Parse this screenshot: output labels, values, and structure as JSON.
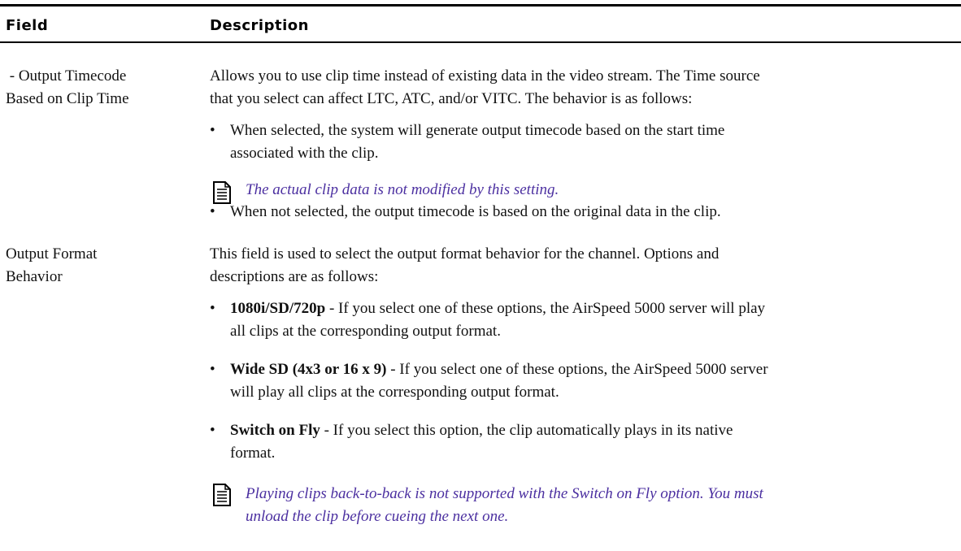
{
  "header": {
    "field": "Field",
    "description": "Description"
  },
  "row1": {
    "field_line1": " - Output Timecode",
    "field_line2": "Based on Clip Time",
    "desc_line1": "Allows you to use clip time instead of existing data in the video stream. The Time source",
    "desc_line2": "that you select can affect LTC, ATC, and/or VITC. The behavior is as follows:",
    "bullet1_line1": "When selected, the system will generate output timecode based on the start time",
    "bullet1_line2": "associated with the clip.",
    "note": "The actual clip data is not modified by this setting.",
    "bullet2": "When not selected, the output timecode is based on the original data in the clip."
  },
  "row2": {
    "field_line1": "Output Format",
    "field_line2": "Behavior",
    "desc_line1": "This field is used to select the output format behavior for the channel. Options and",
    "desc_line2": "descriptions are as follows:",
    "bullets": [
      {
        "bold": "1080i/SD/720p",
        "rest_line1": " - If you select one of these options, the AirSpeed 5000 server will play",
        "line2": "all clips at the corresponding output format."
      },
      {
        "bold": "Wide SD (4x3 or 16 x 9)",
        "rest_line1": " - If you select one of these options, the AirSpeed 5000 server",
        "line2": "will play all clips at the corresponding output format."
      },
      {
        "bold": "Switch on Fly",
        "rest_line1": " - If you select this option, the clip automatically plays in its native",
        "line2": "format."
      }
    ],
    "note_line1": "Playing clips back-to-back is not supported with the Switch on Fly option. You must",
    "note_line2": "unload the clip before cueing the next one."
  },
  "bullet_symbol": "•",
  "icons": {
    "note": "note-icon"
  },
  "colors": {
    "note_text": "#4b2fa0",
    "rule": "#000000"
  }
}
